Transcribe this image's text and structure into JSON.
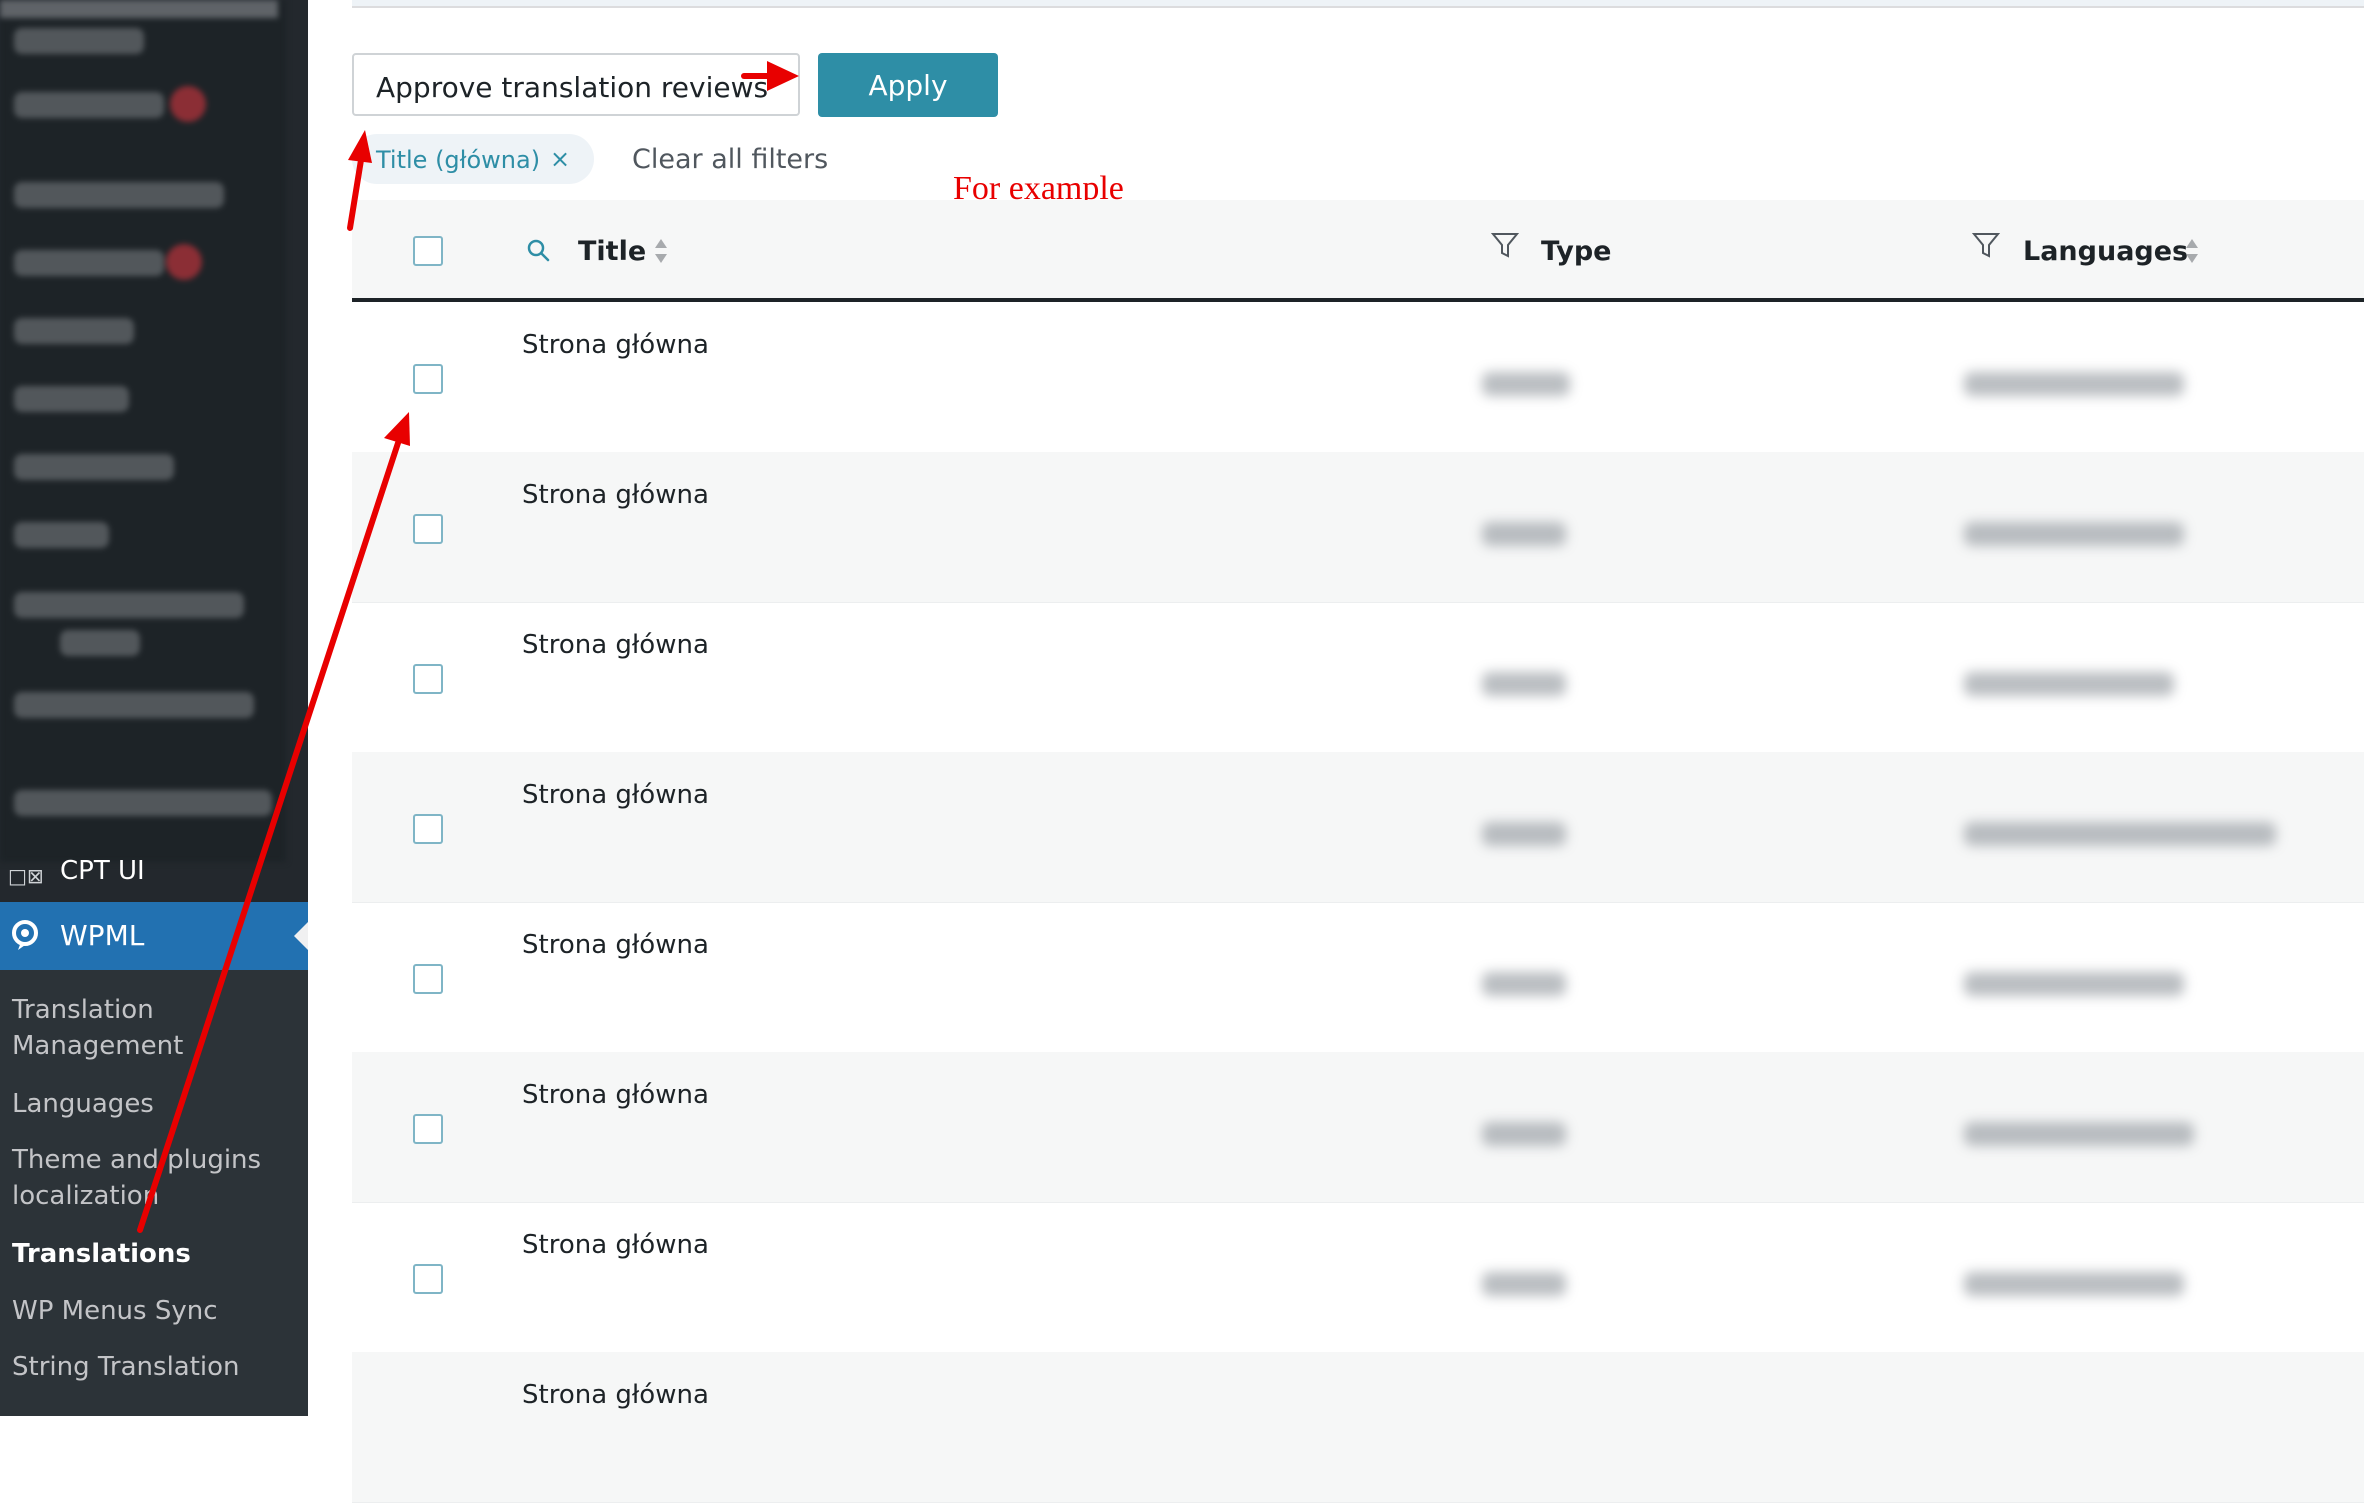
{
  "sidebar": {
    "cpt_ui_label": "CPT UI",
    "wpml_label": "WPML",
    "submenu": [
      {
        "label": "Translation Management"
      },
      {
        "label": "Languages"
      },
      {
        "label": "Theme and plugins localization"
      },
      {
        "label": "Translations"
      },
      {
        "label": "WP Menus Sync"
      },
      {
        "label": "String Translation"
      }
    ],
    "current_submenu": "Translations"
  },
  "toolbar": {
    "bulk_action_value": "Approve translation reviews",
    "apply_label": "Apply"
  },
  "filters": {
    "active_filter_label": "Title (główna)",
    "remove_filter_glyph": "×",
    "clear_all_label": "Clear all filters"
  },
  "annotation": {
    "text": "For example",
    "color": "#e80000"
  },
  "table": {
    "columns": [
      {
        "label": "Title",
        "icon": "search-icon",
        "sortable": true
      },
      {
        "label": "Type",
        "icon": "filter-icon",
        "sortable": false
      },
      {
        "label": "Languages",
        "icon": "filter-icon",
        "sortable": true
      }
    ],
    "rows": [
      {
        "title": "Strona główna"
      },
      {
        "title": "Strona główna"
      },
      {
        "title": "Strona główna"
      },
      {
        "title": "Strona główna"
      },
      {
        "title": "Strona główna"
      },
      {
        "title": "Strona główna"
      },
      {
        "title": "Strona główna"
      },
      {
        "title": "Strona główna"
      }
    ]
  },
  "colors": {
    "sidebar_bg": "#23282d",
    "accent": "#2e8ea6",
    "wpml_highlight": "#2271b1"
  }
}
